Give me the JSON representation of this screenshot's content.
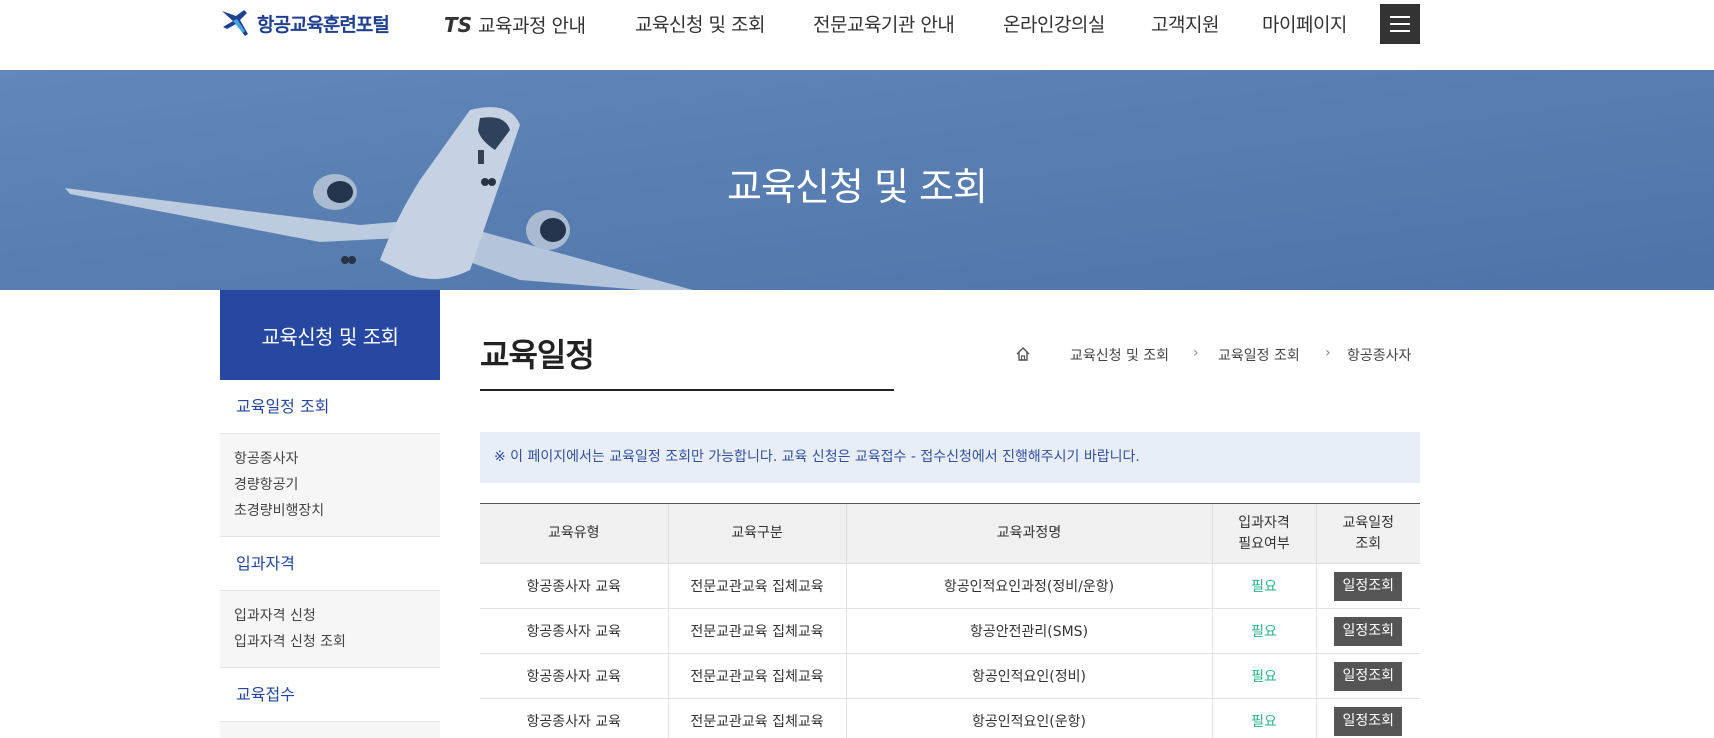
{
  "header": {
    "logo_text": "항공교육훈련포털",
    "nav": [
      {
        "prefix": "TS",
        "label": "교육과정 안내"
      },
      {
        "prefix": "",
        "label": "교육신청 및 조회"
      },
      {
        "prefix": "",
        "label": "전문교육기관 안내"
      },
      {
        "prefix": "",
        "label": "온라인강의실"
      },
      {
        "prefix": "",
        "label": "고객지원"
      },
      {
        "prefix": "",
        "label": "마이페이지"
      }
    ]
  },
  "banner": {
    "title": "교육신청 및 조회"
  },
  "sidebar": {
    "title": "교육신청 및 조회",
    "groups": [
      {
        "label": "교육일정 조회",
        "items": [
          "항공종사자",
          "경량항공기",
          "초경량비행장치"
        ]
      },
      {
        "label": "입과자격",
        "items": [
          "입과자격 신청",
          "입과자격 신청 조회"
        ]
      },
      {
        "label": "교육접수",
        "items": []
      }
    ]
  },
  "main": {
    "title": "교육일정",
    "breadcrumb": [
      "교육신청 및 조회",
      "교육일정 조회",
      "항공종사자"
    ],
    "notice": "※ 이 페이지에서는 교육일정 조회만 가능합니다. 교육 신청은 교육접수 - 접수신청에서 진행해주시기 바랍니다.",
    "table": {
      "headers": [
        "교육유형",
        "교육구분",
        "교육과정명",
        "입과자격 필요여부",
        "교육일정 조회"
      ],
      "header_lines": [
        [
          "교육유형"
        ],
        [
          "교육구분"
        ],
        [
          "교육과정명"
        ],
        [
          "입과자격",
          "필요여부"
        ],
        [
          "교육일정",
          "조회"
        ]
      ],
      "rows": [
        {
          "type": "항공종사자 교육",
          "category": "전문교관교육 집체교육",
          "course": "항공인적요인과정(정비/운항)",
          "required": "필요",
          "action": "일정조회"
        },
        {
          "type": "항공종사자 교육",
          "category": "전문교관교육 집체교육",
          "course": "항공안전관리(SMS)",
          "required": "필요",
          "action": "일정조회"
        },
        {
          "type": "항공종사자 교육",
          "category": "전문교관교육 집체교육",
          "course": "항공인적요인(정비)",
          "required": "필요",
          "action": "일정조회"
        },
        {
          "type": "항공종사자 교육",
          "category": "전문교관교육 집체교육",
          "course": "항공인적요인(운항)",
          "required": "필요",
          "action": "일정조회"
        }
      ]
    }
  },
  "colors": {
    "brand": "#2648a0",
    "banner": "#5a7fb0",
    "required": "#2bb38a",
    "button": "#555555"
  }
}
